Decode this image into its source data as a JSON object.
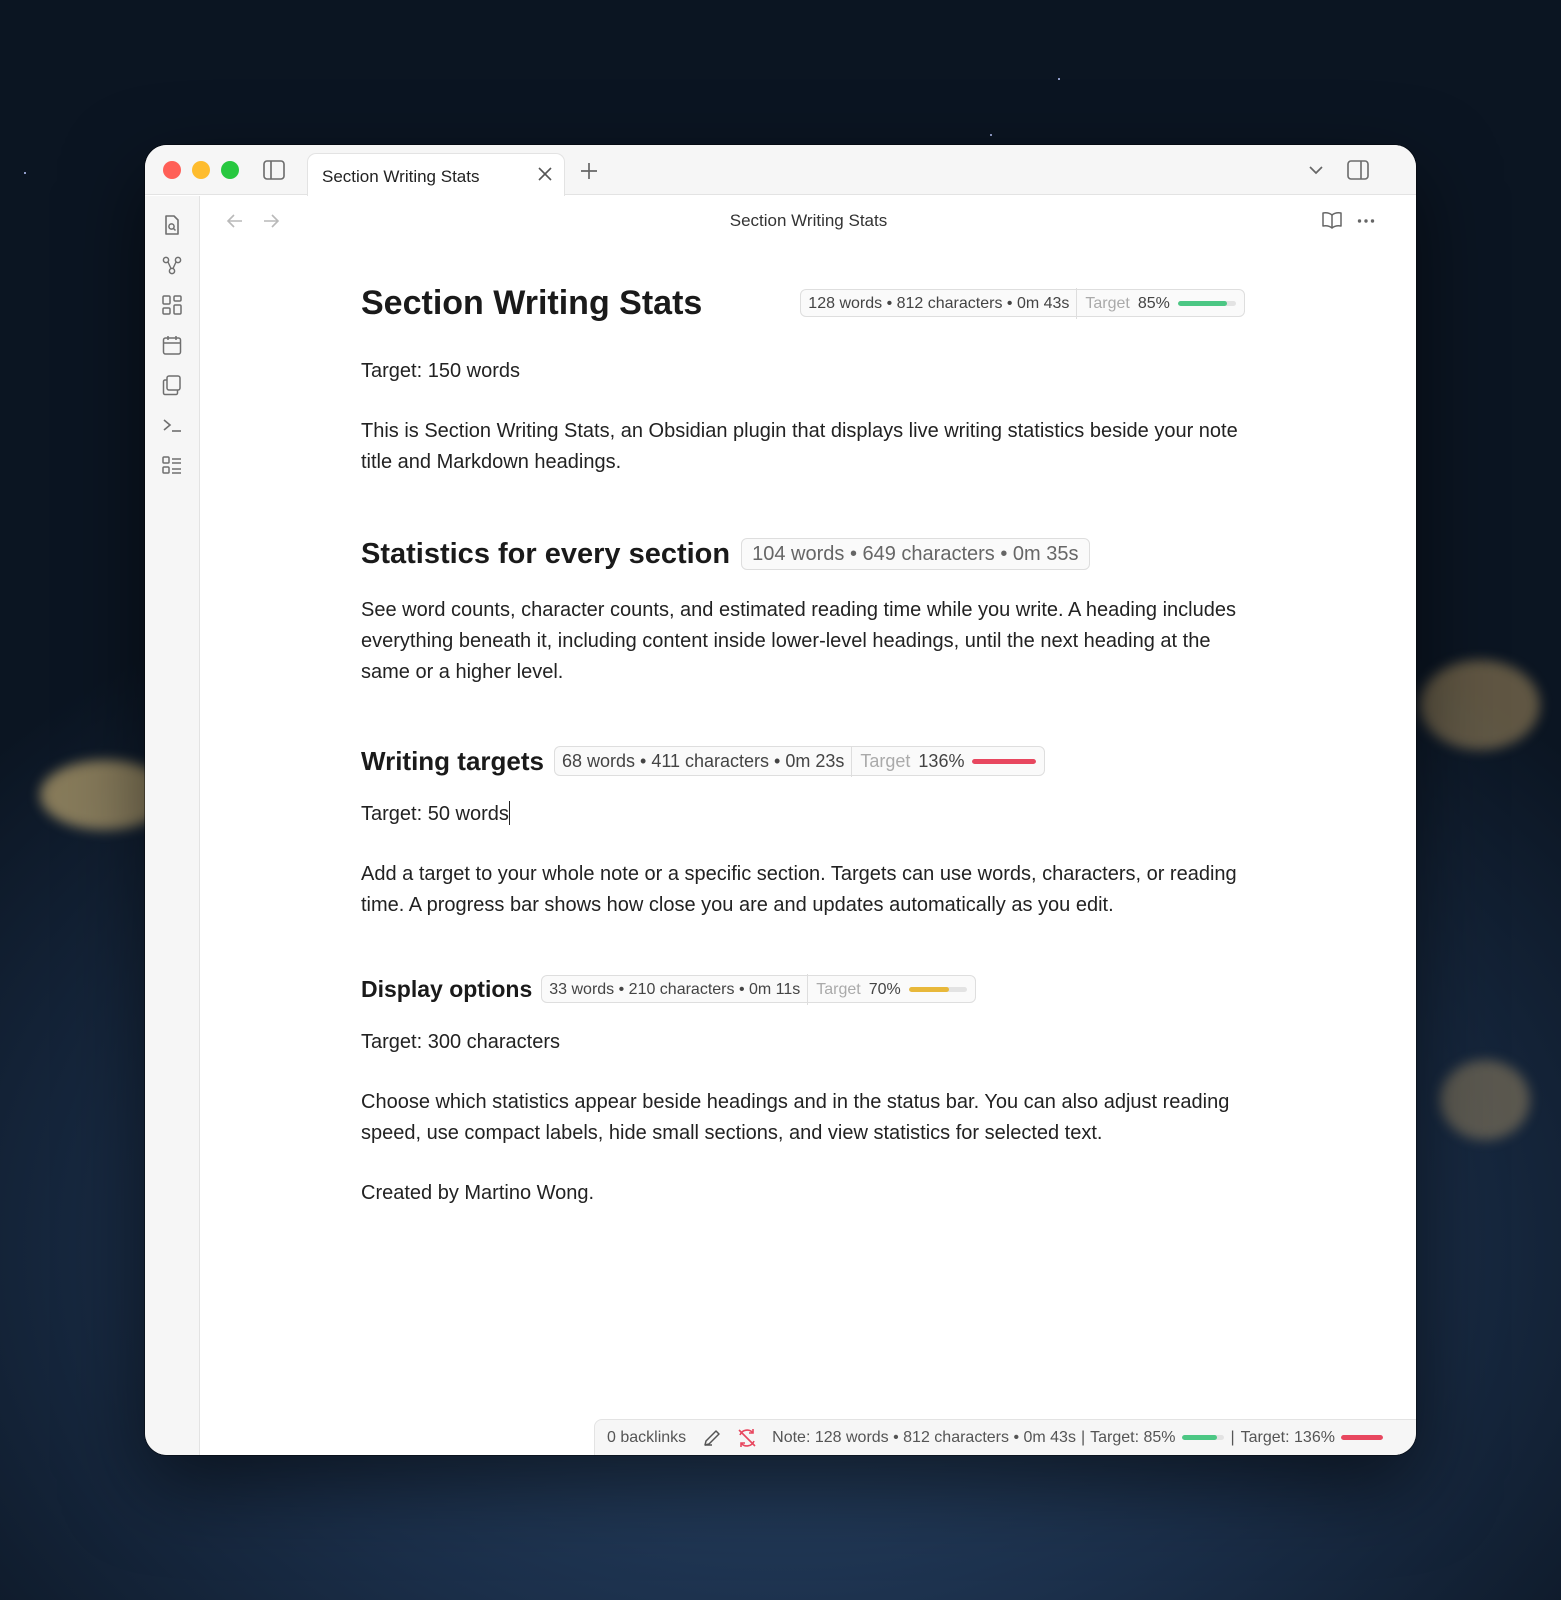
{
  "tab": {
    "title": "Section Writing Stats"
  },
  "view": {
    "title": "Section Writing Stats"
  },
  "note": {
    "title": "Section Writing Stats",
    "title_stats": "128 words • 812 characters • 0m 43s",
    "title_target_label": "Target",
    "title_target_pct": "85%",
    "title_target_fraction": 0.85,
    "target_line": "Target: 150 words",
    "intro": "This is Section Writing Stats, an Obsidian plugin that displays live writing statistics beside your note title and Markdown headings."
  },
  "sections": {
    "s1": {
      "heading": "Statistics for every section",
      "stats": "104 words • 649 characters • 0m 35s",
      "body": "See word counts, character counts, and estimated reading time while you write. A heading includes everything beneath it, including content inside lower-level headings, until the next heading at the same or a higher level."
    },
    "s2": {
      "heading": "Writing targets",
      "stats": "68 words • 411 characters • 0m 23s",
      "target_label": "Target",
      "target_pct": "136%",
      "target_fraction": 1.0,
      "target_line": "Target: 50 words",
      "body": "Add a target to your whole note or a specific section. Targets can use words, characters, or reading time. A progress bar shows how close you are and updates automatically as you edit."
    },
    "s3": {
      "heading": "Display options",
      "stats": "33 words • 210 characters • 0m 11s",
      "target_label": "Target",
      "target_pct": "70%",
      "target_fraction": 0.7,
      "target_line": "Target: 300 characters",
      "body": "Choose which statistics appear beside headings and in the status bar. You can also adjust reading speed, use compact labels, hide small sections, and view statistics for selected text.",
      "credit": "Created by Martino Wong."
    }
  },
  "statusbar": {
    "backlinks": "0 backlinks",
    "note_stats": "Note: 128 words • 812 characters • 0m 43s",
    "sep": "|",
    "target1": "Target: 85%",
    "target1_fraction": 0.85,
    "target2": "Target: 136%",
    "target2_fraction": 1.0
  },
  "colors": {
    "green": "#4cc784",
    "red": "#e8475f",
    "yellow": "#e8b83a"
  },
  "icons": {
    "ribbon": [
      "file-search-icon",
      "graph-icon",
      "grid-icon",
      "calendar-icon",
      "copy-icon",
      "terminal-icon",
      "list-icon"
    ]
  }
}
